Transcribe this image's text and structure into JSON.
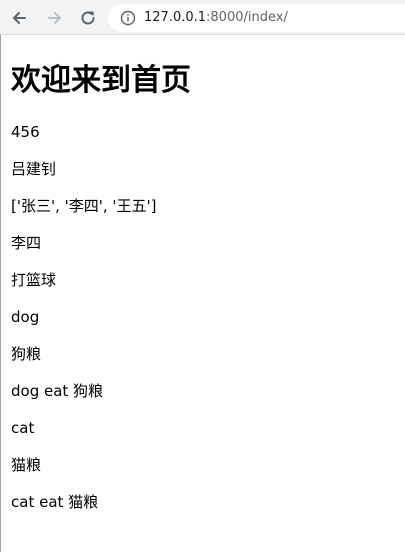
{
  "browser": {
    "url_host": "127.0.0.1",
    "url_rest": ":8000/index/"
  },
  "page": {
    "heading": "欢迎来到首页",
    "lines": [
      "456",
      "吕建钊",
      "['张三', '李四', '王五']",
      "李四",
      "打篮球",
      "dog",
      "狗粮",
      "dog eat 狗粮",
      "cat",
      "猫粮",
      "cat eat 猫粮"
    ]
  }
}
